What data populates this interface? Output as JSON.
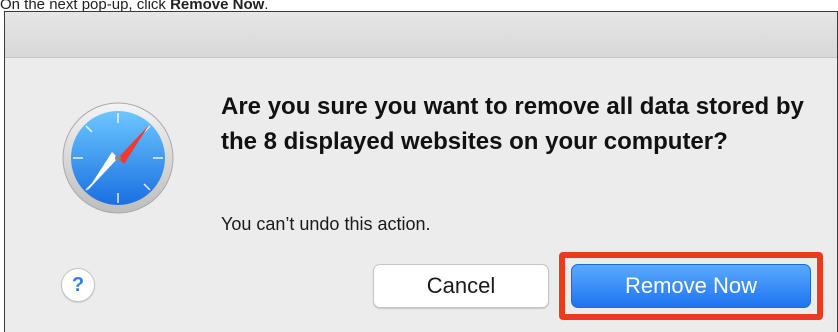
{
  "instruction": {
    "prefix": "On the next pop-up, click ",
    "emphasis": "Remove Now",
    "suffix": "."
  },
  "dialog": {
    "app_icon": "safari-compass-icon",
    "message": "Are you sure you want to remove all data stored by the 8 displayed websites on your computer?",
    "informative_text": "You can’t undo this action.",
    "help_label": "?",
    "cancel_label": "Cancel",
    "confirm_label": "Remove Now"
  },
  "colors": {
    "highlight": "#ec3a1e",
    "primary_button": "#1f74f0",
    "dialog_background": "#ececec"
  }
}
